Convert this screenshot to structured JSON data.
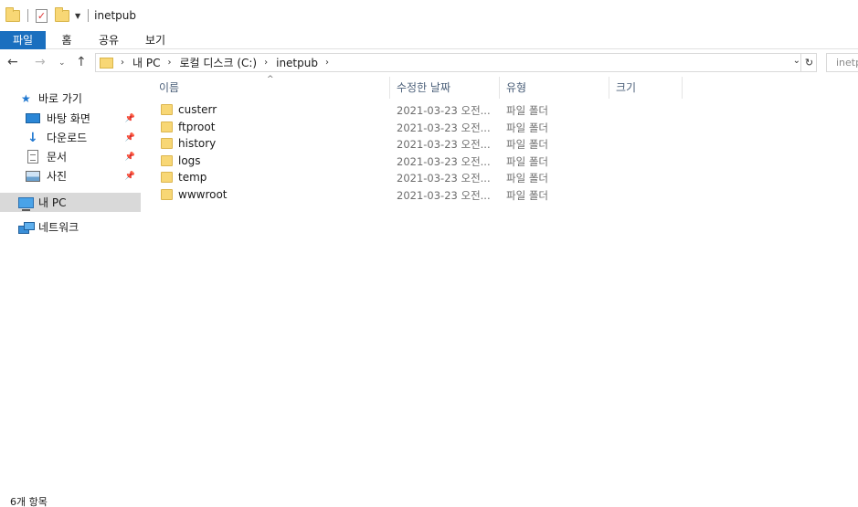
{
  "window": {
    "title": "inetpub"
  },
  "ribbon": {
    "tabs": [
      {
        "label": "파일"
      },
      {
        "label": "홈"
      },
      {
        "label": "공유"
      },
      {
        "label": "보기"
      }
    ]
  },
  "address": {
    "crumbs": [
      "내 PC",
      "로컬 디스크 (C:)",
      "inetpub"
    ],
    "search_placeholder": "inetpub"
  },
  "sidebar": {
    "items": [
      {
        "label": "바로 가기",
        "icon": "star-icon",
        "pinned": false
      },
      {
        "label": "바탕 화면",
        "icon": "desktop-icon",
        "pinned": true
      },
      {
        "label": "다운로드",
        "icon": "download-icon",
        "pinned": true
      },
      {
        "label": "문서",
        "icon": "document-icon",
        "pinned": true
      },
      {
        "label": "사진",
        "icon": "pictures-icon",
        "pinned": true
      },
      {
        "label": "내 PC",
        "icon": "computer-icon",
        "selected": true
      },
      {
        "label": "네트워크",
        "icon": "network-icon"
      }
    ]
  },
  "columns": {
    "name": "이름",
    "date": "수정한 날짜",
    "type": "유형",
    "size": "크기"
  },
  "files": [
    {
      "name": "custerr",
      "date": "2021-03-23 오전...",
      "type": "파일 폴더"
    },
    {
      "name": "ftproot",
      "date": "2021-03-23 오전...",
      "type": "파일 폴더"
    },
    {
      "name": "history",
      "date": "2021-03-23 오전...",
      "type": "파일 폴더"
    },
    {
      "name": "logs",
      "date": "2021-03-23 오전...",
      "type": "파일 폴더"
    },
    {
      "name": "temp",
      "date": "2021-03-23 오전...",
      "type": "파일 폴더"
    },
    {
      "name": "wwwroot",
      "date": "2021-03-23 오전...",
      "type": "파일 폴더"
    }
  ],
  "status": {
    "item_count": "6개 항목"
  },
  "colors": {
    "file_tab": "#1a6fbf",
    "folder": "#f8d775",
    "selected": "#d9d9d9",
    "header_text": "#4c607a"
  }
}
